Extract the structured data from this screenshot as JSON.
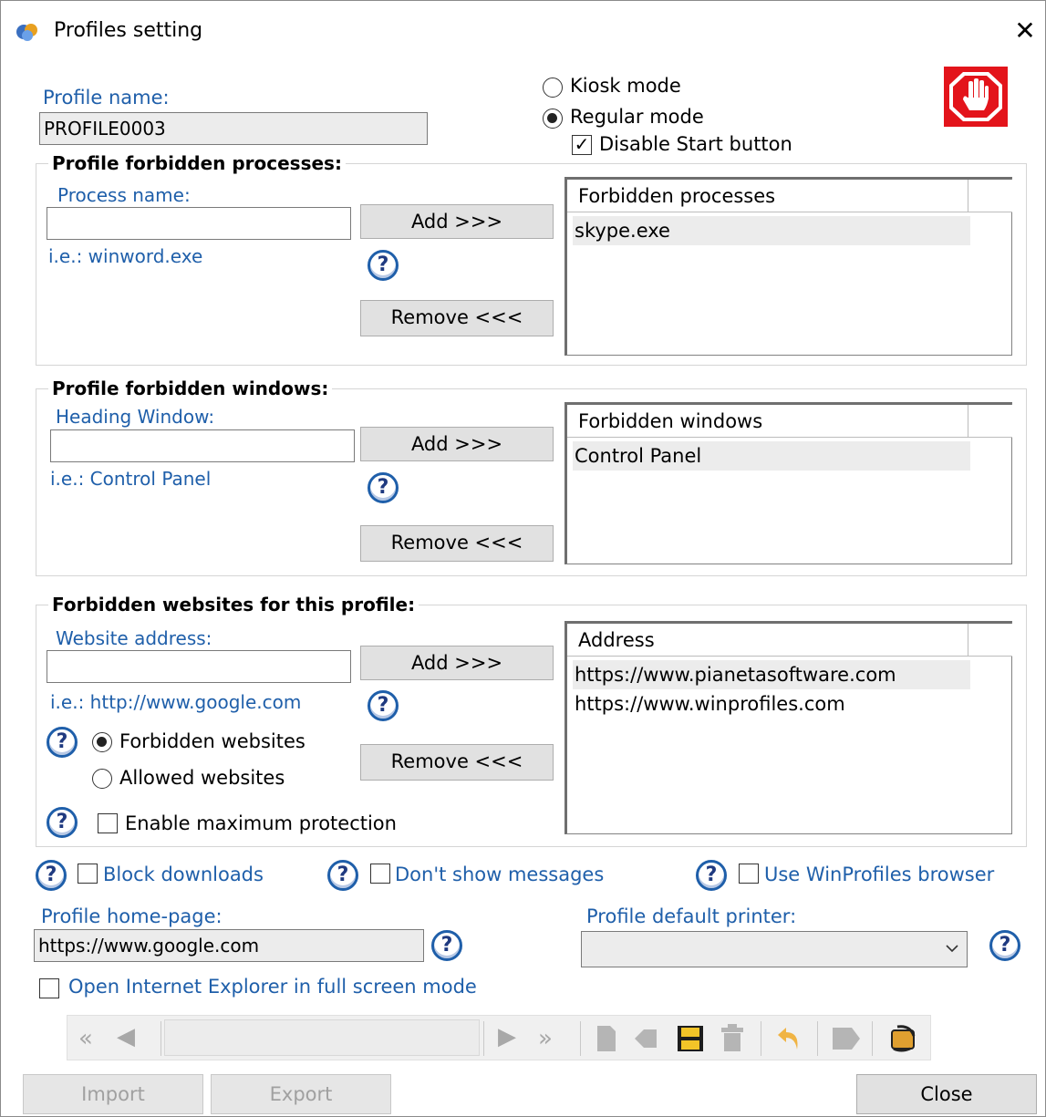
{
  "window": {
    "title": "Profiles setting"
  },
  "profile_name": {
    "label": "Profile name:",
    "value": "PROFILE0003"
  },
  "mode": {
    "kiosk_label": "Kiosk mode",
    "regular_label": "Regular mode",
    "selected": "regular",
    "disable_start_label": "Disable Start button",
    "disable_start_checked": true
  },
  "processes": {
    "group_title": "Profile forbidden processes:",
    "input_label": "Process name:",
    "input_value": "",
    "example": "i.e.: winword.exe",
    "add_label": "Add >>>",
    "remove_label": "Remove <<<",
    "list_header": "Forbidden processes",
    "items": [
      "skype.exe"
    ]
  },
  "windows": {
    "group_title": "Profile forbidden windows:",
    "input_label": "Heading Window:",
    "input_value": "",
    "example": "i.e.: Control Panel",
    "add_label": "Add >>>",
    "remove_label": "Remove <<<",
    "list_header": "Forbidden windows",
    "items": [
      "Control Panel"
    ]
  },
  "websites": {
    "group_title": "Forbidden websites for this profile:",
    "input_label": "Website address:",
    "input_value": "",
    "example": "i.e.: http://www.google.com",
    "add_label": "Add >>>",
    "remove_label": "Remove <<<",
    "list_header": "Address",
    "items": [
      "https://www.pianetasoftware.com",
      "https://www.winprofiles.com"
    ],
    "forbidden_label": "Forbidden websites",
    "allowed_label": "Allowed websites",
    "selected": "forbidden",
    "max_protection_label": "Enable maximum protection",
    "max_protection_checked": false
  },
  "options": {
    "block_downloads_label": "Block downloads",
    "dont_show_messages_label": "Don't show messages",
    "use_browser_label": "Use WinProfiles browser"
  },
  "home_page": {
    "label": "Profile home-page:",
    "value": "https://www.google.com"
  },
  "printer": {
    "label": "Profile default printer:",
    "value": ""
  },
  "open_ie_label": "Open Internet Explorer in full screen mode",
  "buttons": {
    "import": "Import",
    "export": "Export",
    "close": "Close"
  },
  "colors": {
    "link_blue": "#1f5faa",
    "stop_red": "#e3141b"
  }
}
